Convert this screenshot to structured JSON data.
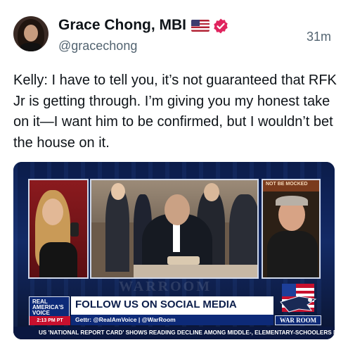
{
  "author": {
    "display_name": "Grace Chong, MBI",
    "handle": "@gracechong",
    "flag_icon": "us-flag-icon",
    "verified_icon": "verified-badge-icon",
    "verified_color": "#e0245e"
  },
  "timestamp": "31m",
  "tweet": {
    "text": "Kelly: I have to tell you, it’s not guaranteed that RFK Jr is getting through. I’m giving you my honest take on it—I want him to be confirmed, but I wouldn’t bet the house on it."
  },
  "media": {
    "type": "video-still",
    "network_brand": "REAL AMERICA'S VOICE",
    "broadcast_time": "2:13 PM PT",
    "headline": "FOLLOW US ON SOCIAL MEDIA",
    "subline": "Gettr: @RealAmVoice | @WarRoom",
    "show_logo_text": "WAR ROOM",
    "watermark_text": "WARROOM",
    "ticker": "US 'NATIONAL REPORT CARD' SHOWS READING DECLINE AMONG MIDDLE-, ELEMENTARY-SCHOOLERS POS",
    "right_frame_banner": "NOT BE MOCKED"
  },
  "colors": {
    "name": "#0f1419",
    "secondary": "#536471",
    "brand_navy": "#0d2a78",
    "brand_red": "#c8102e"
  }
}
